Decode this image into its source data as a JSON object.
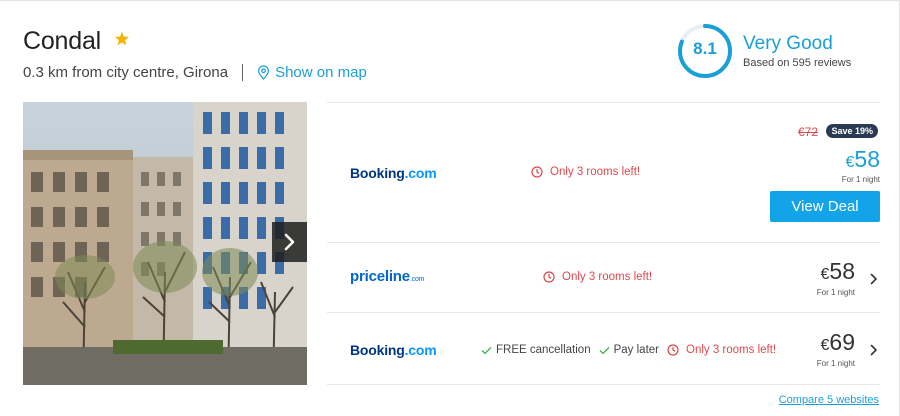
{
  "hotel": {
    "name": "Condal",
    "location": "0.3 km from city centre, Girona",
    "map_link": "Show on map"
  },
  "rating": {
    "score": "8.1",
    "score_fraction": 0.81,
    "label": "Very Good",
    "reviews": "Based on 595 reviews"
  },
  "deals": [
    {
      "provider": "Booking.com",
      "provider_name": "Booking",
      "provider_suffix": ".com",
      "rooms_left": "Only 3 rooms left!",
      "old_price": "€72",
      "save_badge": "Save 19%",
      "currency": "€",
      "price": "58",
      "per_night": "For 1 night",
      "cta": "View Deal"
    },
    {
      "provider": "priceline.com",
      "provider_name": "priceline",
      "provider_suffix": ".com",
      "rooms_left": "Only 3 rooms left!",
      "currency": "€",
      "price": "58",
      "per_night": "For 1 night"
    },
    {
      "provider": "Booking.com",
      "provider_name": "Booking",
      "provider_suffix": ".com",
      "features": [
        "FREE cancellation",
        "Pay later"
      ],
      "rooms_left": "Only 3 rooms left!",
      "currency": "€",
      "price": "69",
      "per_night": "For 1 night"
    }
  ],
  "compare_link": "Compare 5 websites",
  "colors": {
    "accent": "#1a9fd8",
    "alert": "#e0474c",
    "star": "#f5b300",
    "badge": "#2a3a52",
    "button": "#12a3e8"
  },
  "icons": [
    "star-icon",
    "map-pin-icon",
    "chevron-right-icon",
    "clock-icon",
    "check-icon"
  ]
}
